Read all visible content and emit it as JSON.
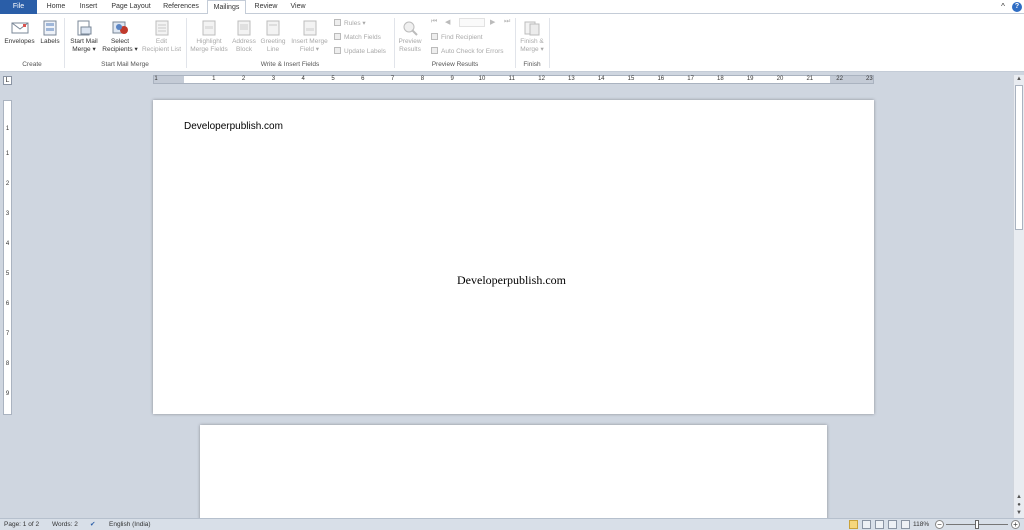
{
  "tabs": [
    {
      "label": "File"
    },
    {
      "label": "Home"
    },
    {
      "label": "Insert"
    },
    {
      "label": "Page Layout"
    },
    {
      "label": "References"
    },
    {
      "label": "Mailings"
    },
    {
      "label": "Review"
    },
    {
      "label": "View"
    }
  ],
  "active_tab": "Mailings",
  "window": {
    "minimize": "^",
    "help": "?"
  },
  "ribbon": {
    "create": {
      "group": "Create",
      "envelopes": "Envelopes",
      "labels": "Labels"
    },
    "start": {
      "group": "Start Mail Merge",
      "start_l1": "Start Mail",
      "start_l2": "Merge",
      "select_l1": "Select",
      "select_l2": "Recipients",
      "edit_l1": "Edit",
      "edit_l2": "Recipient List"
    },
    "write": {
      "group": "Write & Insert Fields",
      "highlight_l1": "Highlight",
      "highlight_l2": "Merge Fields",
      "address_l1": "Address",
      "address_l2": "Block",
      "greeting_l1": "Greeting",
      "greeting_l2": "Line",
      "insert_l1": "Insert Merge",
      "insert_l2": "Field",
      "rules": "Rules",
      "match": "Match Fields",
      "update": "Update Labels"
    },
    "preview": {
      "group": "Preview Results",
      "preview_l1": "Preview",
      "preview_l2": "Results",
      "find": "Find Recipient",
      "auto": "Auto Check for Errors"
    },
    "finish": {
      "group": "Finish",
      "finish_l1": "Finish &",
      "finish_l2": "Merge"
    }
  },
  "ruler_h": [
    "1",
    "1",
    "2",
    "3",
    "4",
    "5",
    "6",
    "7",
    "8",
    "9",
    "10",
    "11",
    "12",
    "13",
    "14",
    "15",
    "16",
    "17",
    "18",
    "19",
    "20",
    "21",
    "22",
    "23"
  ],
  "ruler_v": [
    "1",
    "1",
    "2",
    "3",
    "4",
    "5",
    "6",
    "7",
    "8",
    "9"
  ],
  "document": {
    "return_address": "Developerpublish.com",
    "delivery_address": "Developerpublish.com"
  },
  "status": {
    "page": "Page: 1 of 2",
    "words": "Words: 2",
    "language": "English (India)",
    "zoom": "118%"
  },
  "colors": {
    "file_tab": "#2a5ea8",
    "background": "#cfd6e0"
  }
}
